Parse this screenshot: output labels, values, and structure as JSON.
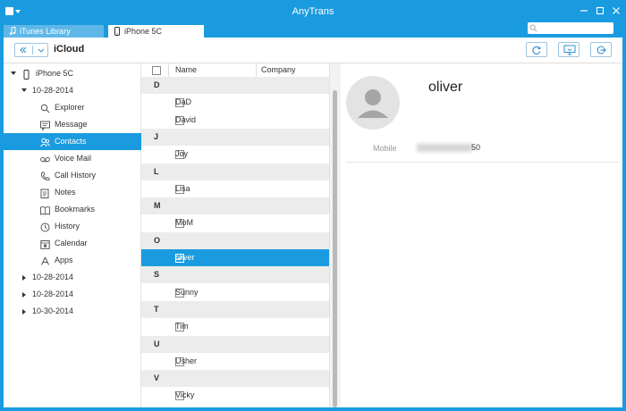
{
  "app": {
    "title": "AnyTrans"
  },
  "tabs": [
    {
      "label": "iTunes Library"
    },
    {
      "label": "iPhone 5C"
    }
  ],
  "toolbar": {
    "breadcrumb": "iCloud"
  },
  "sidebar": {
    "device": "iPhone 5C",
    "backup": "10-28-2014",
    "items": [
      {
        "label": "Explorer",
        "icon": "search-icon"
      },
      {
        "label": "Message",
        "icon": "message-icon"
      },
      {
        "label": "Contacts",
        "icon": "contacts-icon",
        "selected": true
      },
      {
        "label": "Voice Mail",
        "icon": "voicemail-icon"
      },
      {
        "label": "Call History",
        "icon": "phone-icon"
      },
      {
        "label": "Notes",
        "icon": "notes-icon"
      },
      {
        "label": "Bookmarks",
        "icon": "bookmark-icon"
      },
      {
        "label": "History",
        "icon": "history-icon"
      },
      {
        "label": "Calendar",
        "icon": "calendar-icon"
      },
      {
        "label": "Apps",
        "icon": "apps-icon"
      }
    ],
    "other_backups": [
      "10-28-2014",
      "10-28-2014",
      "10-30-2014"
    ]
  },
  "list": {
    "columns": [
      "Name",
      "Company"
    ],
    "rows": [
      {
        "type": "letter",
        "text": "D"
      },
      {
        "type": "contact",
        "text": "DaD"
      },
      {
        "type": "contact",
        "text": "David"
      },
      {
        "type": "letter",
        "text": "J"
      },
      {
        "type": "contact",
        "text": "Joy"
      },
      {
        "type": "letter",
        "text": "L"
      },
      {
        "type": "contact",
        "text": "Lisa"
      },
      {
        "type": "letter",
        "text": "M"
      },
      {
        "type": "contact",
        "text": "MoM"
      },
      {
        "type": "letter",
        "text": "O"
      },
      {
        "type": "contact",
        "text": "oliver",
        "selected": true
      },
      {
        "type": "letter",
        "text": "S"
      },
      {
        "type": "contact",
        "text": "Sunny"
      },
      {
        "type": "letter",
        "text": "T"
      },
      {
        "type": "contact",
        "text": "Tim"
      },
      {
        "type": "letter",
        "text": "U"
      },
      {
        "type": "contact",
        "text": "Usher"
      },
      {
        "type": "letter",
        "text": "V"
      },
      {
        "type": "contact",
        "text": "Vicky"
      }
    ]
  },
  "detail": {
    "name": "oliver",
    "mobile_label": "Mobile",
    "mobile_visible": "50"
  },
  "colors": {
    "accent": "#1a9be0",
    "letter_row": "#ececec"
  }
}
